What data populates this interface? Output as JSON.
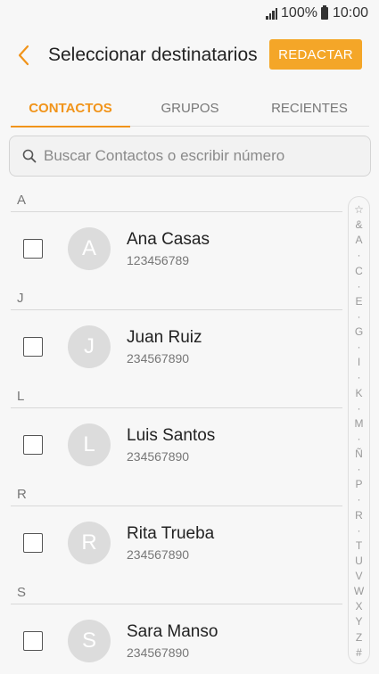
{
  "status_bar": {
    "battery": "100%",
    "time": "10:00"
  },
  "header": {
    "title": "Seleccionar destinatarios",
    "compose_label": "REDACTAR"
  },
  "tabs": [
    {
      "label": "CONTACTOS",
      "active": true
    },
    {
      "label": "GRUPOS",
      "active": false
    },
    {
      "label": "RECIENTES",
      "active": false
    }
  ],
  "search": {
    "placeholder": "Buscar Contactos o escribir número"
  },
  "sections": [
    {
      "letter": "A",
      "contacts": [
        {
          "initial": "A",
          "name": "Ana Casas",
          "number": "123456789",
          "checked": false
        }
      ]
    },
    {
      "letter": "J",
      "contacts": [
        {
          "initial": "J",
          "name": "Juan Ruiz",
          "number": "234567890",
          "checked": false
        }
      ]
    },
    {
      "letter": "L",
      "contacts": [
        {
          "initial": "L",
          "name": "Luis Santos",
          "number": "234567890",
          "checked": false
        }
      ]
    },
    {
      "letter": "R",
      "contacts": [
        {
          "initial": "R",
          "name": "Rita Trueba",
          "number": "234567890",
          "checked": false
        }
      ]
    },
    {
      "letter": "S",
      "contacts": [
        {
          "initial": "S",
          "name": "Sara Manso",
          "number": "234567890",
          "checked": false
        }
      ]
    }
  ],
  "index_bar": [
    "☆",
    "&",
    "A",
    "·",
    "C",
    "·",
    "E",
    "·",
    "G",
    "·",
    "I",
    "·",
    "K",
    "·",
    "M",
    "·",
    "Ñ",
    "·",
    "P",
    "·",
    "R",
    "·",
    "T",
    "U",
    "V",
    "W",
    "X",
    "Y",
    "Z",
    "#"
  ],
  "colors": {
    "accent": "#f1941a",
    "button": "#f4a628",
    "avatar": "#dcdcdc",
    "background": "#f7f7f7"
  }
}
